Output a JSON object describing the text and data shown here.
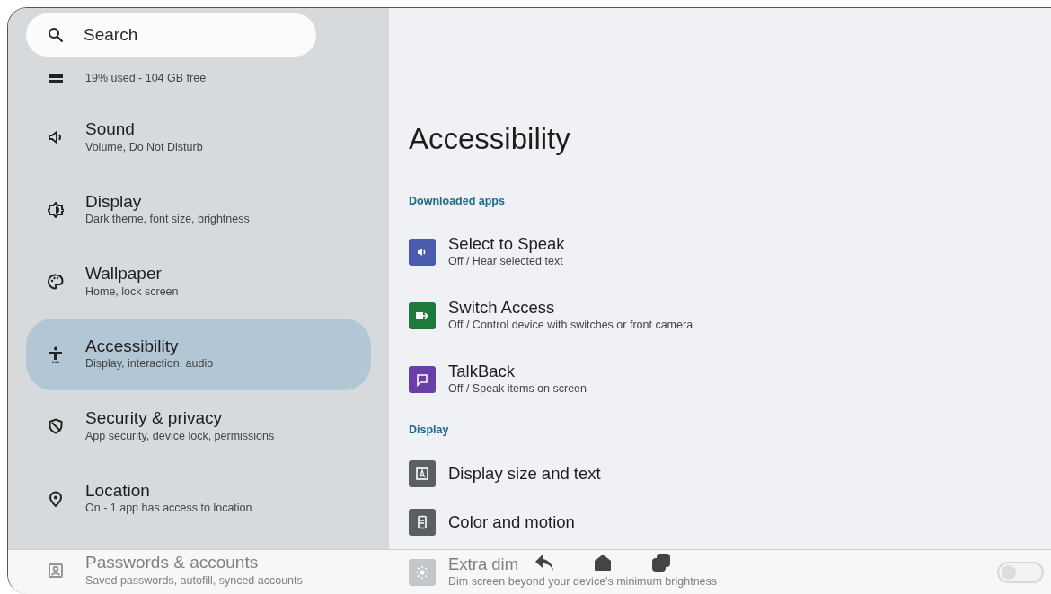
{
  "search": {
    "placeholder": "Search"
  },
  "sidebar": {
    "items": [
      {
        "subtitle": "19% used - 104 GB free",
        "selected": false
      },
      {
        "title": "Sound",
        "subtitle": "Volume, Do Not Disturb",
        "selected": false
      },
      {
        "title": "Display",
        "subtitle": "Dark theme, font size, brightness",
        "selected": false
      },
      {
        "title": "Wallpaper",
        "subtitle": "Home, lock screen",
        "selected": false
      },
      {
        "title": "Accessibility",
        "subtitle": "Display, interaction, audio",
        "selected": true
      },
      {
        "title": "Security & privacy",
        "subtitle": "App security, device lock, permissions",
        "selected": false
      },
      {
        "title": "Location",
        "subtitle": "On - 1 app has access to location",
        "selected": false
      },
      {
        "title": "Passwords & accounts",
        "subtitle": "Saved passwords, autofill, synced accounts",
        "selected": false
      }
    ]
  },
  "page_title": "Accessibility",
  "sections": [
    {
      "header": "Downloaded apps",
      "items": [
        {
          "kind": "link",
          "color": "#4a5bb0",
          "title": "Select to Speak",
          "subtitle": "Off / Hear selected text"
        },
        {
          "kind": "link",
          "color": "#1e7a3c",
          "title": "Switch Access",
          "subtitle": "Off / Control device with switches or front camera"
        },
        {
          "kind": "link",
          "color": "#6a3fa8",
          "title": "TalkBack",
          "subtitle": "Off / Speak items on screen"
        }
      ]
    },
    {
      "header": "Display",
      "items": [
        {
          "kind": "link",
          "color": "#5b5f63",
          "title": "Display size and text"
        },
        {
          "kind": "link",
          "color": "#5b5f63",
          "title": "Color and motion"
        },
        {
          "kind": "toggle",
          "color": "#c4c7ca",
          "title": "Extra dim",
          "subtitle": "Dim screen beyond your device's minimum brightness",
          "on": false
        }
      ]
    }
  ]
}
